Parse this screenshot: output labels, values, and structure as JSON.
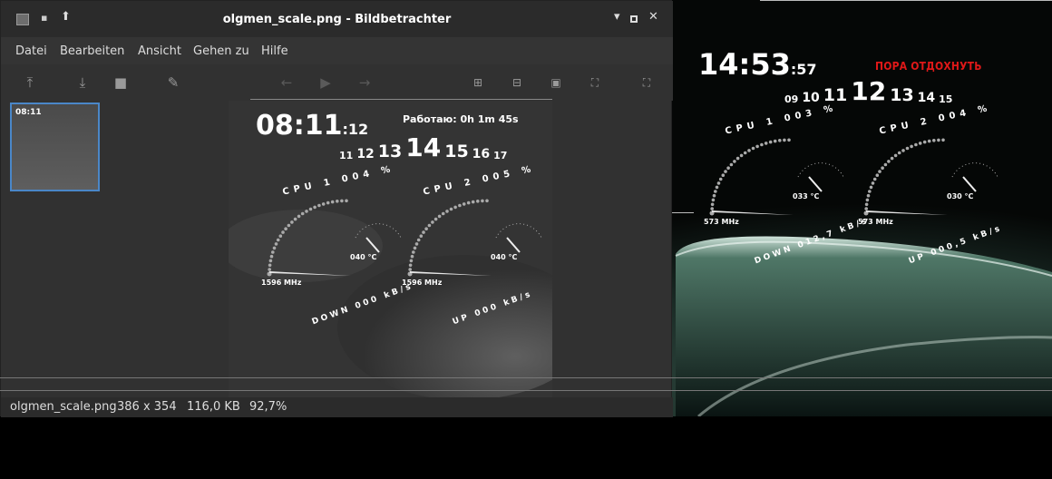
{
  "window": {
    "title": "olgmen_scale.png - Bildbetrachter",
    "menu": [
      "Datei",
      "Bearbeiten",
      "Ansicht",
      "Gehen zu",
      "Hilfe"
    ],
    "status": {
      "filename": "olgmen_scale.png",
      "dimensions": "386 x 354",
      "filesize": "116,0 KB",
      "zoom": "92,7%"
    }
  },
  "toolbar_icons": [
    "upload-icon",
    "save-icon",
    "trash-icon",
    "pencil-icon",
    "arrow-left-icon",
    "play-icon",
    "arrow-right-icon",
    "zoom-in-icon",
    "zoom-out-icon",
    "original-size-icon",
    "fit-icon",
    "fullscreen-icon"
  ],
  "desktop": {
    "clock_hm": "14:53",
    "clock_s": ":57",
    "message": "ПОРА ОТДОХНУТЬ",
    "hours": [
      "09",
      "10",
      "11",
      "12",
      "13",
      "14",
      "15"
    ],
    "cpu1": {
      "label": "CPU 1 003 %",
      "temp": "033 °C",
      "freq": "573 MHz",
      "net": "DOWN 012,7 kB/s"
    },
    "cpu2": {
      "label": "CPU 2 004 %",
      "temp": "030 °C",
      "freq": "573 MHz",
      "net": "UP 000,5 kB/s"
    }
  },
  "image": {
    "clock_hm": "08:11",
    "clock_s": ":12",
    "uptime": "Работаю: 0h 1m 45s",
    "hours": [
      "11",
      "12",
      "13",
      "14",
      "15",
      "16",
      "17"
    ],
    "cpu1": {
      "label": "CPU 1 004 %",
      "temp": "040 °C",
      "freq": "1596 MHz",
      "net": "DOWN 000 kB/s"
    },
    "cpu2": {
      "label": "CPU 2 005 %",
      "temp": "040 °C",
      "freq": "1596 MHz",
      "net": "UP 000 kB/s"
    }
  }
}
